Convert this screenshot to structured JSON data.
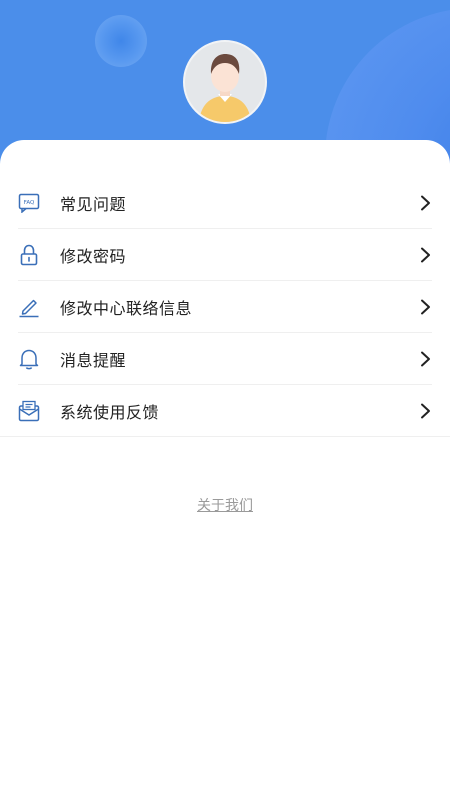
{
  "colors": {
    "header_blue": "#4b8eea",
    "icon_blue": "#3a6fb8",
    "text_primary": "#222222",
    "link_gray": "#9a9a9a"
  },
  "avatar": {
    "icon": "user-avatar"
  },
  "menu": {
    "items": [
      {
        "label": "常见问题",
        "icon": "faq-icon"
      },
      {
        "label": "修改密码",
        "icon": "lock-icon"
      },
      {
        "label": "修改中心联络信息",
        "icon": "pencil-icon"
      },
      {
        "label": "消息提醒",
        "icon": "bell-icon"
      },
      {
        "label": "系统使用反馈",
        "icon": "mail-icon"
      }
    ]
  },
  "about_link": "关于我们"
}
